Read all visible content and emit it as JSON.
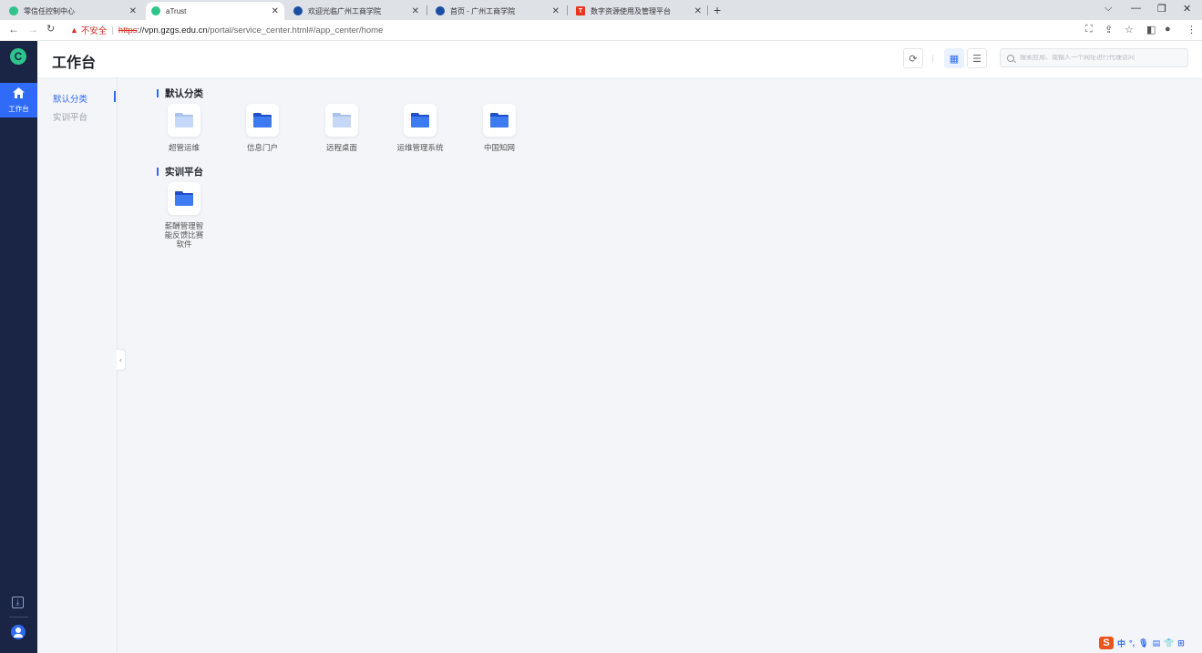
{
  "browser": {
    "tabs": [
      {
        "title": "零信任控制中心",
        "active": false,
        "favicon_color": "#2ec48b"
      },
      {
        "title": "aTrust",
        "active": true,
        "favicon_color": "#2ec48b"
      },
      {
        "title": "欢迎光临广州工商学院",
        "active": false,
        "favicon_color": "#1a4fa3"
      },
      {
        "title": "首页 - 广州工商学院",
        "active": false,
        "favicon_color": "#1a4fa3"
      },
      {
        "title": "数字资源使用及管理平台",
        "active": false,
        "favicon_color": "#e8351d"
      }
    ],
    "new_tab": "+",
    "address": {
      "security_label": "不安全",
      "scheme": "https",
      "host_rest": "://vpn.gzgs.edu.cn",
      "path": "/portal/service_center.html#/app_center/home"
    }
  },
  "sidebar": {
    "logo": "C",
    "items": [
      {
        "label": "工作台",
        "active": true
      }
    ]
  },
  "header": {
    "title": "工作台",
    "search_placeholder": "搜索应用、或输入一个网址进行代理访问"
  },
  "category_nav": [
    {
      "label": "默认分类",
      "active": true
    },
    {
      "label": "实训平台",
      "active": false
    }
  ],
  "sections": [
    {
      "title": "默认分类",
      "apps": [
        {
          "name": "超管运维",
          "folder_style": "light"
        },
        {
          "name": "信息门户",
          "folder_style": "dark"
        },
        {
          "name": "远程桌面",
          "folder_style": "light"
        },
        {
          "name": "运维管理系统",
          "folder_style": "dark"
        },
        {
          "name": "中国知网",
          "folder_style": "dark"
        }
      ]
    },
    {
      "title": "实训平台",
      "apps": [
        {
          "name": "薪酬管理智能反馈比赛软件",
          "folder_style": "dark"
        }
      ]
    }
  ],
  "ime": {
    "brand": "S",
    "mode": "中"
  },
  "colors": {
    "accent": "#2f6bf6",
    "sidebar_bg": "#1a2445",
    "content_bg": "#f4f5f9",
    "insecure": "#d93025"
  }
}
